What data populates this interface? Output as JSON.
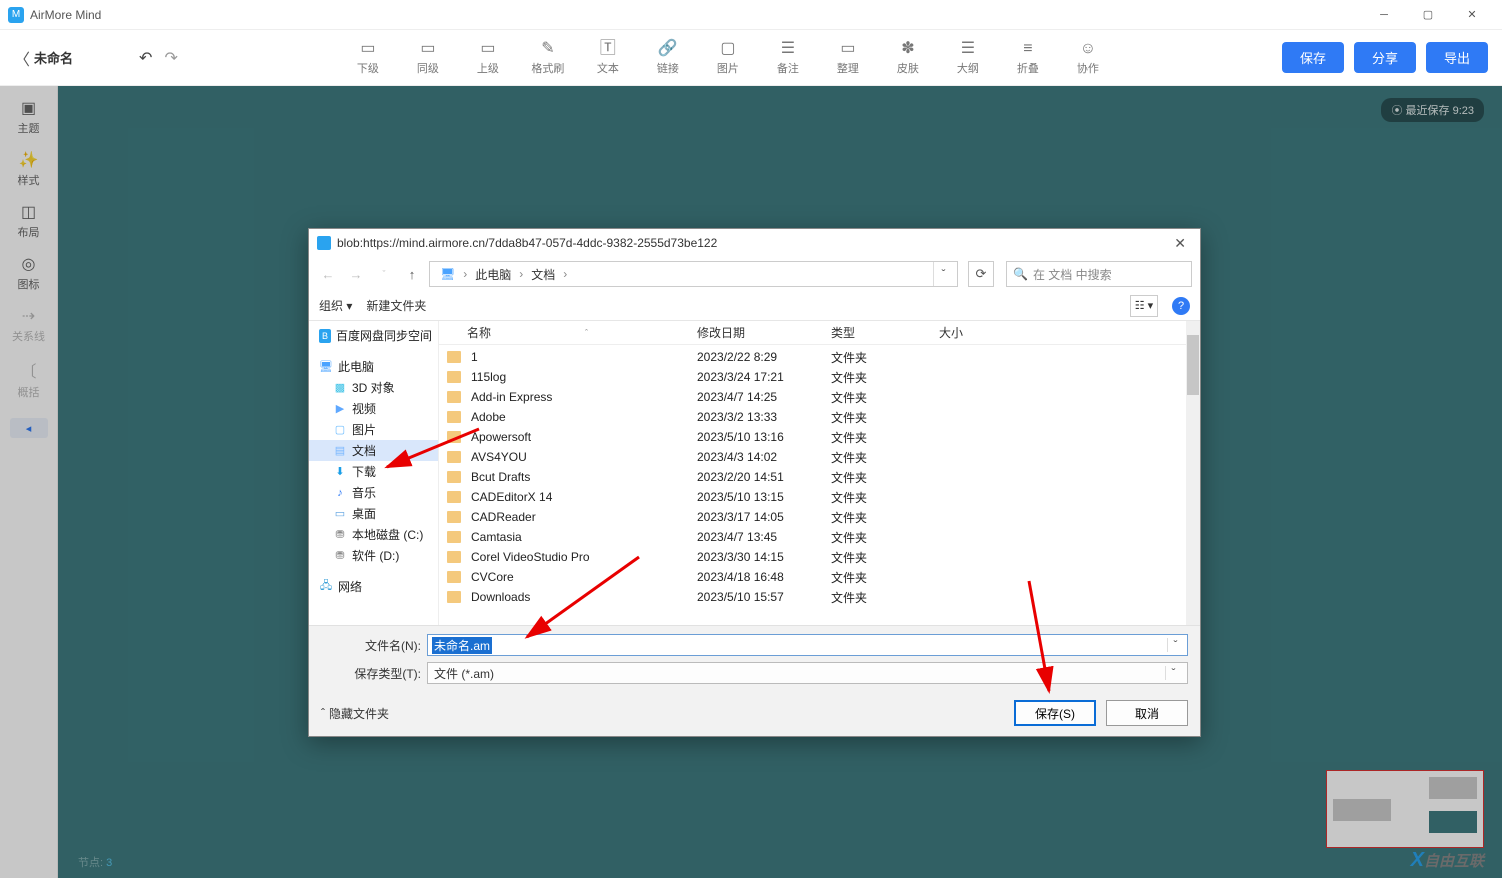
{
  "titlebar": {
    "app": "AirMore Mind"
  },
  "toolbar": {
    "doc_name": "未命名",
    "items": [
      {
        "label": "下级",
        "glyph": "▭"
      },
      {
        "label": "同级",
        "glyph": "▭"
      },
      {
        "label": "上级",
        "glyph": "▭"
      },
      {
        "label": "格式刷",
        "glyph": "✎"
      },
      {
        "label": "文本",
        "glyph": "🅃"
      },
      {
        "label": "链接",
        "glyph": "🔗"
      },
      {
        "label": "图片",
        "glyph": "▢"
      },
      {
        "label": "备注",
        "glyph": "☰"
      },
      {
        "label": "整理",
        "glyph": "▭"
      },
      {
        "label": "皮肤",
        "glyph": "✽"
      },
      {
        "label": "大纲",
        "glyph": "☰"
      },
      {
        "label": "折叠",
        "glyph": "≡"
      },
      {
        "label": "协作",
        "glyph": "☺"
      }
    ],
    "save": "保存",
    "share": "分享",
    "export": "导出"
  },
  "rail": [
    {
      "label": "主题",
      "glyph": "▣"
    },
    {
      "label": "样式",
      "glyph": "✨"
    },
    {
      "label": "布局",
      "glyph": "◫"
    },
    {
      "label": "图标",
      "glyph": "◎"
    },
    {
      "label": "关系线",
      "glyph": "⇢",
      "dis": true
    },
    {
      "label": "概括",
      "glyph": "〔",
      "dis": true
    }
  ],
  "canvas": {
    "save_badge": "⦿ 最近保存 9:23",
    "status_label": "节点:",
    "status_value": "3",
    "watermark": "自由互联"
  },
  "dialog": {
    "title": "blob:https://mind.airmore.cn/7dda8b47-057d-4ddc-9382-2555d73be122",
    "breadcrumb": [
      "此电脑",
      "文档"
    ],
    "search_placeholder": "在 文档 中搜索",
    "organize": "组织",
    "newfolder": "新建文件夹",
    "columns": {
      "name": "名称",
      "date": "修改日期",
      "type": "类型",
      "size": "大小"
    },
    "tree": [
      {
        "label": "百度网盘同步空间",
        "icon": "baidu",
        "level": 1
      },
      {
        "label": "此电脑",
        "icon": "monitor",
        "level": 1
      },
      {
        "label": "3D 对象",
        "icon": "cube",
        "level": 2
      },
      {
        "label": "视频",
        "icon": "video",
        "level": 2
      },
      {
        "label": "图片",
        "icon": "pic",
        "level": 2
      },
      {
        "label": "文档",
        "icon": "doc",
        "level": 2,
        "selected": true
      },
      {
        "label": "下载",
        "icon": "down",
        "level": 2
      },
      {
        "label": "音乐",
        "icon": "music",
        "level": 2
      },
      {
        "label": "桌面",
        "icon": "desk",
        "level": 2
      },
      {
        "label": "本地磁盘 (C:)",
        "icon": "drive",
        "level": 2
      },
      {
        "label": "软件 (D:)",
        "icon": "drive",
        "level": 2
      },
      {
        "label": "网络",
        "icon": "net",
        "level": 1
      }
    ],
    "files": [
      {
        "name": "1",
        "date": "2023/2/22 8:29",
        "type": "文件夹"
      },
      {
        "name": "115log",
        "date": "2023/3/24 17:21",
        "type": "文件夹"
      },
      {
        "name": "Add-in Express",
        "date": "2023/4/7 14:25",
        "type": "文件夹"
      },
      {
        "name": "Adobe",
        "date": "2023/3/2 13:33",
        "type": "文件夹"
      },
      {
        "name": "Apowersoft",
        "date": "2023/5/10 13:16",
        "type": "文件夹"
      },
      {
        "name": "AVS4YOU",
        "date": "2023/4/3 14:02",
        "type": "文件夹"
      },
      {
        "name": "Bcut Drafts",
        "date": "2023/2/20 14:51",
        "type": "文件夹"
      },
      {
        "name": "CADEditorX 14",
        "date": "2023/5/10 13:15",
        "type": "文件夹"
      },
      {
        "name": "CADReader",
        "date": "2023/3/17 14:05",
        "type": "文件夹"
      },
      {
        "name": "Camtasia",
        "date": "2023/4/7 13:45",
        "type": "文件夹"
      },
      {
        "name": "Corel VideoStudio Pro",
        "date": "2023/3/30 14:15",
        "type": "文件夹"
      },
      {
        "name": "CVCore",
        "date": "2023/4/18 16:48",
        "type": "文件夹"
      },
      {
        "name": "Downloads",
        "date": "2023/5/10 15:57",
        "type": "文件夹"
      }
    ],
    "filename_label": "文件名(N):",
    "filename_value": "未命名.am",
    "savetype_label": "保存类型(T):",
    "savetype_value": "文件 (*.am)",
    "hide_folders": "隐藏文件夹",
    "save_btn": "保存(S)",
    "cancel_btn": "取消"
  }
}
